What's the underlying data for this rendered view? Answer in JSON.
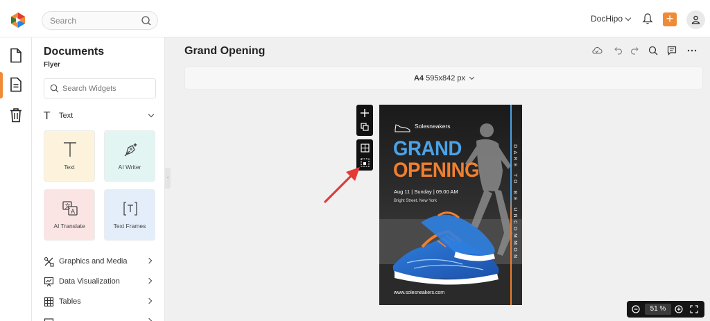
{
  "topbar": {
    "search_placeholder": "Search",
    "brand_label": "DocHipo",
    "plus_label": "+",
    "accent_color": "#f08a34"
  },
  "rail": {
    "items": [
      {
        "name": "document",
        "icon": "file-icon"
      },
      {
        "name": "text-document",
        "icon": "document-lines-icon",
        "active": true
      },
      {
        "name": "trash",
        "icon": "trash-icon"
      }
    ]
  },
  "panel": {
    "title": "Documents",
    "subtitle": "Flyer",
    "search_placeholder": "Search Widgets",
    "section_text": "Text",
    "tiles": [
      {
        "label": "Text",
        "icon": "text-t-icon",
        "bg": "#fdf3dc"
      },
      {
        "label": "AI Writer",
        "icon": "pen-nib-icon",
        "bg": "#e3f5f2"
      },
      {
        "label": "AI Translate",
        "icon": "translate-icon",
        "bg": "#fbe4e4"
      },
      {
        "label": "Text Frames",
        "icon": "text-frame-icon",
        "bg": "#e4eefa"
      }
    ],
    "rows": [
      {
        "label": "Graphics and Media",
        "icon": "shapes-icon"
      },
      {
        "label": "Data Visualization",
        "icon": "presentation-chart-icon"
      },
      {
        "label": "Tables",
        "icon": "table-icon"
      }
    ]
  },
  "main": {
    "doc_title": "Grand Opening",
    "size_label": "A4",
    "size_dims": "595x842 px",
    "tools": [
      "cloud-icon",
      "undo-icon",
      "redo-icon",
      "search-icon",
      "comment-icon",
      "more-icon"
    ]
  },
  "flyer": {
    "brand": "Solesneakers",
    "headline_1": "GRAND",
    "headline_2": "OPENING",
    "date_line": "Aug 11 | Sunday | 09.00 AM",
    "address": "Bright Street. New York",
    "tagline": "DARE TO BE UNCOMMON",
    "website": "www.solesneakers.com",
    "blue": "#4aa3e8",
    "orange": "#f07f2f"
  },
  "zoom": {
    "value": "51 %"
  },
  "annotation": {
    "arrow_color": "#e53935"
  }
}
